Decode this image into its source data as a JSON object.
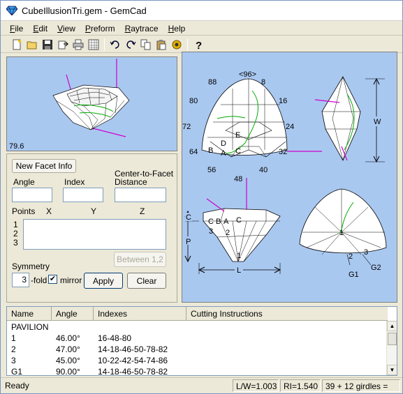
{
  "window": {
    "title": "CubeIllusionTri.gem - GemCad"
  },
  "menu": [
    {
      "label": "File",
      "key": "F"
    },
    {
      "label": "Edit",
      "key": "E"
    },
    {
      "label": "View",
      "key": "V"
    },
    {
      "label": "Preform",
      "key": "P"
    },
    {
      "label": "Raytrace",
      "key": "R"
    },
    {
      "label": "Help",
      "key": "H"
    }
  ],
  "toolbar": {
    "icons": [
      "new-icon",
      "open-icon",
      "save-icon",
      "export-icon",
      "print-icon",
      "grid-icon",
      "undo-icon",
      "redo-icon",
      "copy-icon",
      "paste-icon",
      "settings-icon",
      "help-icon"
    ]
  },
  "small_view": {
    "angle_readout": "79.6"
  },
  "facet_panel": {
    "new_facet_btn": "New Facet Info",
    "angle_label": "Angle",
    "index_label": "Index",
    "ctf_label_1": "Center-to-Facet",
    "ctf_label_2": "Distance",
    "points_label": "Points",
    "x_label": "X",
    "y_label": "Y",
    "z_label": "Z",
    "row1": "1",
    "row2": "2",
    "row3": "3",
    "between_btn": "Between 1,2",
    "symmetry_label": "Symmetry",
    "symmetry_value": "3",
    "fold_label": "-fold",
    "mirror_label": "mirror",
    "mirror_checked": true,
    "apply_btn": "Apply",
    "clear_btn": "Clear"
  },
  "big_view": {
    "index_labels": {
      "top": "<96>",
      "l88": "88",
      "r8": "8",
      "l80": "80",
      "r16": "16",
      "l72": "72",
      "r24": "24",
      "l64": "64",
      "r32": "32",
      "l56": "56",
      "r40": "40",
      "b48": "48"
    },
    "top_facets": {
      "E": "E",
      "D": "D",
      "B": "B",
      "A": "A",
      "C": "C"
    },
    "side_facets": {
      "C": "C",
      "B": "B",
      "A": "A",
      "C2": "C",
      "n3": "3",
      "n2": "2",
      "n1": "1"
    },
    "dims": {
      "W": "W",
      "L": "L",
      "C": "C",
      "P": "P"
    },
    "pav_labels": {
      "n1": "1",
      "n2": "2",
      "n3": "3",
      "G1": "G1",
      "G2": "G2"
    }
  },
  "table": {
    "columns": [
      "Name",
      "Angle",
      "Indexes",
      "Cutting Instructions"
    ],
    "rows": [
      {
        "name": "PAVILION",
        "angle": "",
        "indexes": ""
      },
      {
        "name": "1",
        "angle": "46.00°",
        "indexes": "16-48-80"
      },
      {
        "name": "2",
        "angle": "47.00°",
        "indexes": "14-18-46-50-78-82"
      },
      {
        "name": "3",
        "angle": "45.00°",
        "indexes": "10-22-42-54-74-86"
      },
      {
        "name": "G1",
        "angle": "90.00°",
        "indexes": "14-18-46-50-78-82"
      }
    ]
  },
  "status": {
    "ready": "Ready",
    "lw": "L/W=1.003",
    "ri": "RI=1.540",
    "girdles": "39 + 12 girdles ="
  },
  "colors": {
    "view_bg": "#a9c8f0",
    "accent_magenta": "#cc00cc",
    "green_line": "#00aa00"
  }
}
